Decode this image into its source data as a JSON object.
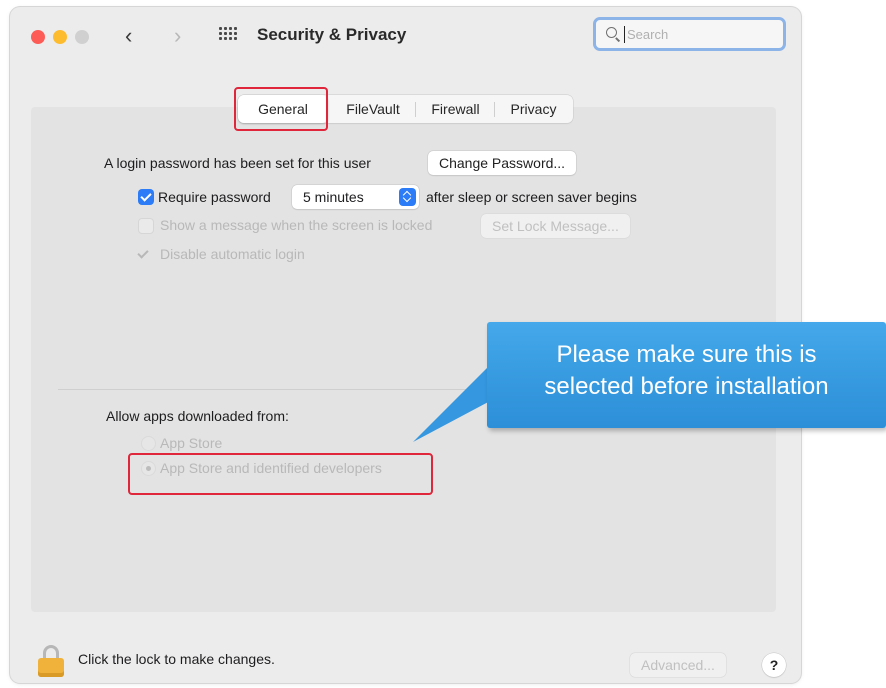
{
  "window": {
    "title": "Security & Privacy",
    "search": {
      "placeholder": "Search"
    },
    "nav": {
      "back": "‹",
      "forward": "›"
    }
  },
  "tabs": [
    {
      "label": "General",
      "selected": true
    },
    {
      "label": "FileVault",
      "selected": false
    },
    {
      "label": "Firewall",
      "selected": false
    },
    {
      "label": "Privacy",
      "selected": false
    }
  ],
  "general": {
    "login_password_text": "A login password has been set for this user",
    "change_password_button": "Change Password...",
    "require_password": {
      "label": "Require password",
      "checked": true,
      "enabled": true
    },
    "require_password_delay": "5 minutes",
    "after_sleep_text": "after sleep or screen saver begins",
    "show_message": {
      "label": "Show a message when the screen is locked",
      "checked": false,
      "enabled": false
    },
    "set_lock_message_button": "Set Lock Message...",
    "disable_auto_login": {
      "label": "Disable automatic login",
      "checked": true,
      "enabled": false
    },
    "allow_apps_label": "Allow apps downloaded from:",
    "allow_apps_options": [
      {
        "label": "App Store",
        "selected": false,
        "enabled": false
      },
      {
        "label": "App Store and identified developers",
        "selected": true,
        "enabled": false
      }
    ]
  },
  "footer": {
    "lock_text": "Click the lock to make changes.",
    "advanced_button": "Advanced...",
    "help_button": "?"
  },
  "callout": {
    "line1": "Please make sure this is",
    "line2": "selected before installation"
  },
  "colors": {
    "accent": "#2b7cf6",
    "highlight_box": "#e0263b",
    "callout_bg": "#3a9de3"
  }
}
